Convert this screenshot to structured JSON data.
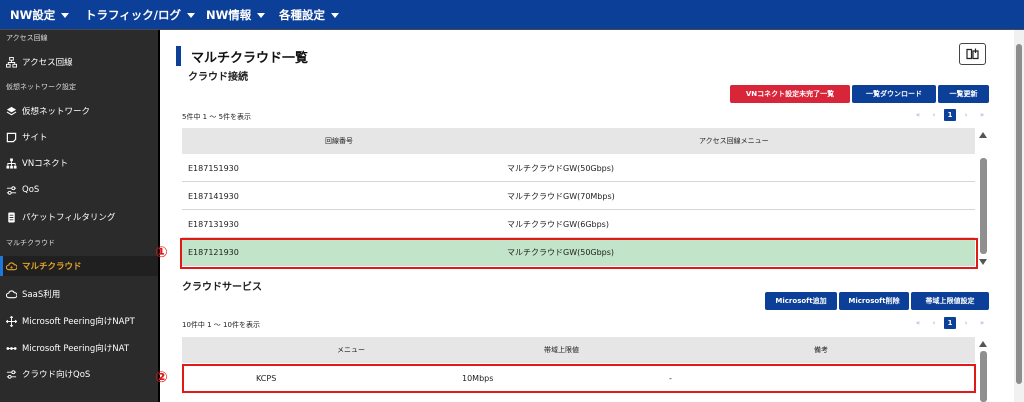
{
  "nav": {
    "items": [
      "NW設定",
      "トラフィック/ログ",
      "NW情報",
      "各種設定"
    ]
  },
  "sidebar": {
    "sections": {
      "access": "アクセス回線",
      "virtual": "仮想ネットワーク設定",
      "multicloud": "マルチクラウド"
    },
    "items": [
      {
        "label": "アクセス回線",
        "icon": "network-tree-icon"
      },
      {
        "label": "仮想ネットワーク",
        "icon": "layers-icon"
      },
      {
        "label": "サイト",
        "icon": "note-icon"
      },
      {
        "label": "VNコネクト",
        "icon": "hierarchy-icon"
      },
      {
        "label": "QoS",
        "icon": "sliders-icon"
      },
      {
        "label": "パケットフィルタリング",
        "icon": "filter-icon"
      },
      {
        "label": "マルチクラウド",
        "icon": "cloud-user-icon"
      },
      {
        "label": "SaaS利用",
        "icon": "cloud-icon"
      },
      {
        "label": "Microsoft Peering向けNAPT",
        "icon": "arrows-cross-icon"
      },
      {
        "label": "Microsoft Peering向けNAT",
        "icon": "dots-icon"
      },
      {
        "label": "クラウド向けQoS",
        "icon": "sliders-icon"
      }
    ],
    "active": "マルチクラウド"
  },
  "page": {
    "title": "マルチクラウド一覧",
    "cloud_connection": {
      "title": "クラウド接続",
      "buttons": [
        "VNコネクト設定未完了一覧",
        "一覧ダウンロード",
        "一覧更新"
      ],
      "count": "5件中 1 ～ 5件を表示",
      "pager": [
        "«",
        "‹",
        "1",
        "›",
        "»"
      ],
      "columns": [
        "回線番号",
        "アクセス回線メニュー"
      ],
      "rows": [
        [
          "E187151930",
          "マルチクラウドGW(50Gbps)"
        ],
        [
          "E187141930",
          "マルチクラウドGW(70Mbps)"
        ],
        [
          "E187131930",
          "マルチクラウドGW(6Gbps)"
        ],
        [
          "E187121930",
          "マルチクラウドGW(50Gbps)"
        ]
      ],
      "annotation": "①"
    },
    "cloud_service": {
      "title": "クラウドサービス",
      "buttons": [
        "Microsoft追加",
        "Microsoft削除",
        "帯域上限値設定"
      ],
      "count": "10件中 1 ～ 10件を表示",
      "pager": [
        "«",
        "‹",
        "1",
        "›",
        "»"
      ],
      "columns": [
        "メニュー",
        "帯域上限値",
        "備考"
      ],
      "rows": [
        [
          "KCPS",
          "10Mbps",
          "-"
        ]
      ],
      "annotation": "②"
    }
  },
  "colors": {
    "nav": "#0c3f98",
    "sidebar": "#2b2b2b",
    "active_text": "#e6a42a",
    "highlight_row": "#c2e4c8",
    "annotation_red": "#e11919",
    "button_red": "#d9253a",
    "button_blue": "#0c3f98"
  }
}
